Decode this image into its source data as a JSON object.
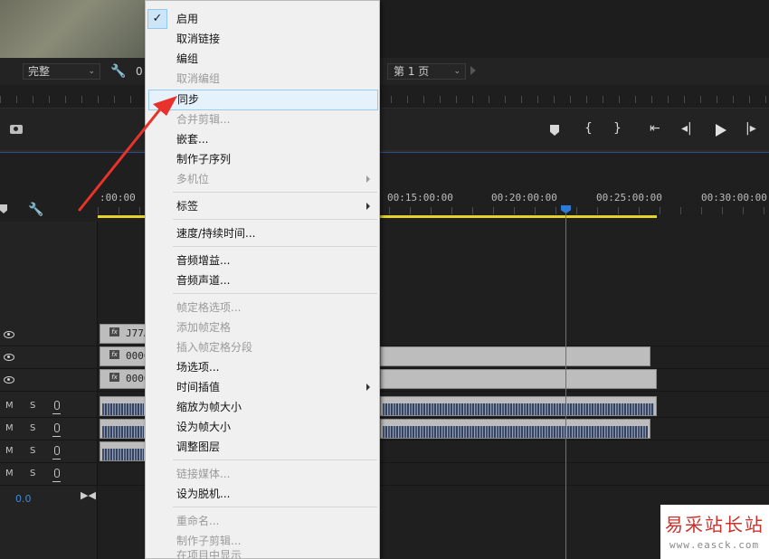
{
  "monitor": {
    "quality_value": "完整",
    "timecode_partial": "0",
    "page_value": "第 1 页"
  },
  "timeline": {
    "tick_labels": [
      ":00:00",
      "00:15:00:00",
      "00:20:00:00",
      "00:25:00:00",
      "00:30:00:00"
    ],
    "clip_names": [
      "J77A",
      "0000",
      "0000"
    ],
    "master_value": "0.0",
    "audio_m": "M",
    "audio_s": "S",
    "fx_label": "fx"
  },
  "context_menu": {
    "items": [
      {
        "label": "启用",
        "enabled": true,
        "checked": true
      },
      {
        "label": "取消链接",
        "enabled": true
      },
      {
        "label": "编组",
        "enabled": true
      },
      {
        "label": "取消编组",
        "enabled": false
      },
      {
        "label": "同步",
        "enabled": true,
        "highlighted": true
      },
      {
        "label": "合并剪辑...",
        "enabled": false
      },
      {
        "label": "嵌套...",
        "enabled": true
      },
      {
        "label": "制作子序列",
        "enabled": true
      },
      {
        "label": "多机位",
        "enabled": false,
        "submenu": true
      },
      {
        "label": "标签",
        "enabled": true,
        "submenu": true
      },
      {
        "label": "速度/持续时间...",
        "enabled": true
      },
      {
        "label": "音频增益...",
        "enabled": true
      },
      {
        "label": "音频声道...",
        "enabled": true
      },
      {
        "label": "帧定格选项...",
        "enabled": false
      },
      {
        "label": "添加帧定格",
        "enabled": false
      },
      {
        "label": "插入帧定格分段",
        "enabled": false
      },
      {
        "label": "场选项...",
        "enabled": true
      },
      {
        "label": "时间插值",
        "enabled": true,
        "submenu": true
      },
      {
        "label": "缩放为帧大小",
        "enabled": true
      },
      {
        "label": "设为帧大小",
        "enabled": true
      },
      {
        "label": "调整图层",
        "enabled": true
      },
      {
        "label": "链接媒体...",
        "enabled": false
      },
      {
        "label": "设为脱机...",
        "enabled": true
      },
      {
        "label": "重命名...",
        "enabled": false
      },
      {
        "label": "制作子剪辑...",
        "enabled": false
      },
      {
        "label": "在项目中显示",
        "enabled": false
      }
    ]
  },
  "watermark": {
    "title": "易采站长站",
    "url": "www.easck.com"
  },
  "colors": {
    "playhead": "#3b79c9",
    "workarea": "#e6d32a",
    "annotation_arrow": "#e8322b",
    "menu_highlight": "#e5f1fb"
  }
}
